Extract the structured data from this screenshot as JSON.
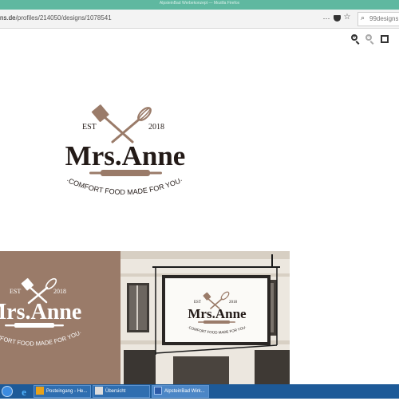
{
  "window": {
    "title": "AlpsteinBad Werbekonzept — Mozilla Firefox"
  },
  "toolbar": {
    "url_prefix": "ns.de",
    "url_path": "/profiles/214050/designs/1078541",
    "search_placeholder": "99designs",
    "menu_icon": "menu-icon",
    "pocket_icon": "pocket-icon",
    "bookmark_icon": "star-icon",
    "search_icon": "search-icon"
  },
  "viewer": {
    "controls": [
      "zoom-in-icon",
      "zoom-out-icon",
      "fullscreen-icon"
    ]
  },
  "logo": {
    "est_left": "EST",
    "est_right": "2018",
    "name": "Mrs.Anne",
    "tagline": "·COMFORT FOOD MADE FOR YOU·",
    "colors": {
      "dark": "#231a17",
      "brown": "#9a7b69",
      "white": "#ffffff"
    }
  },
  "taskbar": {
    "tasks": [
      {
        "label": "Posteingang - He..."
      },
      {
        "label": "Übersicht"
      },
      {
        "label": "AlpsteinBad Wirk..."
      }
    ]
  }
}
